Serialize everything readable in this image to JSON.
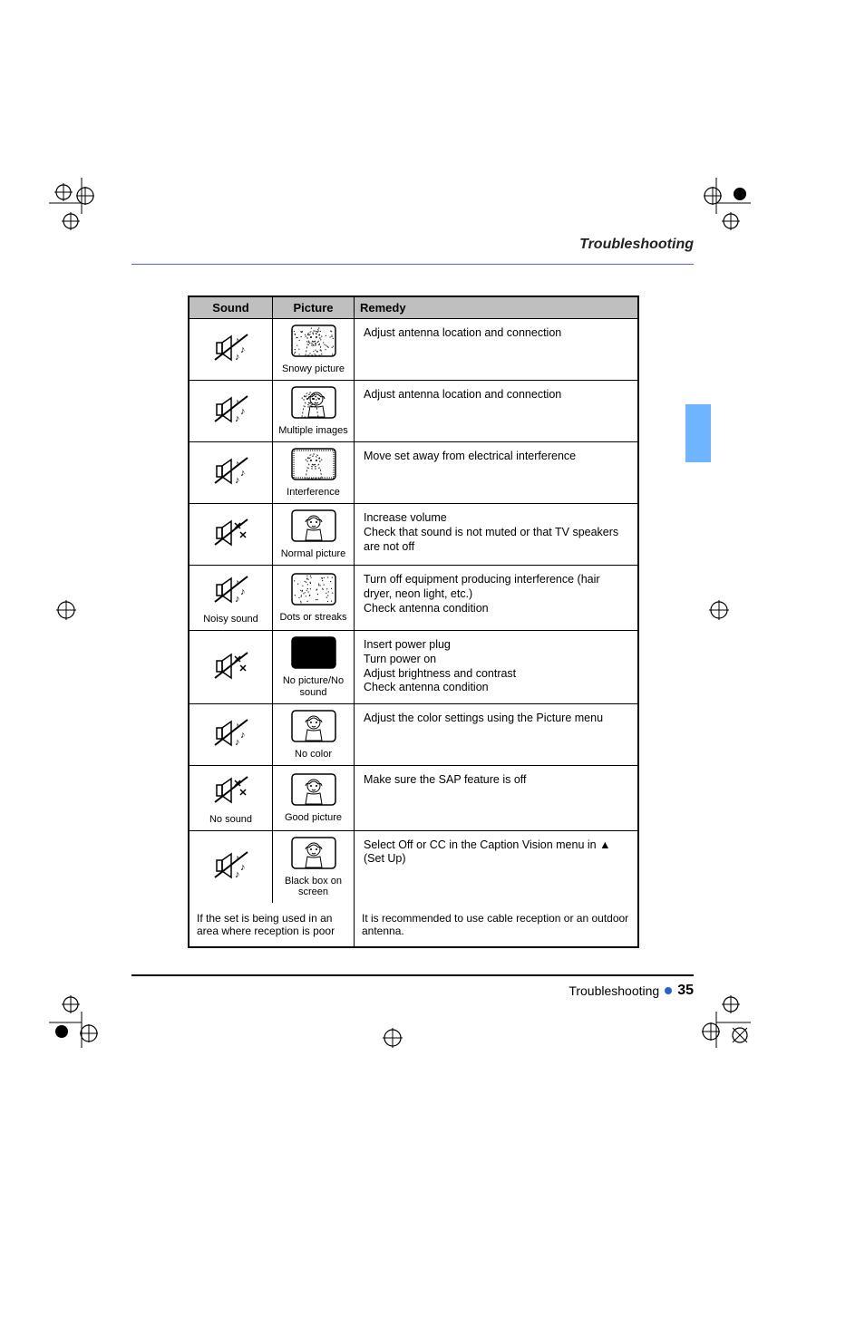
{
  "header": {
    "title": "Troubleshooting"
  },
  "sideTab": {
    "color": "#6fb4ff"
  },
  "table": {
    "headers": {
      "c1": "Sound",
      "c2": "Picture",
      "c3": "Remedy"
    },
    "rows": [
      {
        "sound": "ok",
        "soundCap": "",
        "pic": "snow",
        "picCap": "Snowy picture",
        "remedy": "Adjust antenna location and connection"
      },
      {
        "sound": "ok",
        "soundCap": "",
        "pic": "ghost",
        "picCap": "Multiple images",
        "remedy": "Adjust antenna location and connection"
      },
      {
        "sound": "ok",
        "soundCap": "",
        "pic": "inter",
        "picCap": "Interference",
        "remedy": "Move set away from electrical interference"
      },
      {
        "sound": "mute",
        "soundCap": "",
        "pic": "ok",
        "picCap": "Normal picture",
        "remedy": "Increase volume\nCheck that sound is not muted or that TV speakers are not off"
      },
      {
        "sound": "ok",
        "soundCap": "Noisy sound",
        "pic": "dots",
        "picCap": "Dots or streaks",
        "remedy": "Turn off equipment producing interference (hair dryer, neon light, etc.)\nCheck antenna condition"
      },
      {
        "sound": "mute",
        "soundCap": "",
        "pic": "black",
        "picCap": "No picture/No sound",
        "remedy": "Insert power plug\nTurn power on\nAdjust brightness and contrast\nCheck antenna condition"
      },
      {
        "sound": "ok",
        "soundCap": "",
        "pic": "ok",
        "picCap": "No color",
        "remedy": "Adjust the color settings using the Picture menu"
      },
      {
        "sound": "mute",
        "soundCap": "No sound",
        "pic": "ok",
        "picCap": "Good picture",
        "remedy": "Make sure the SAP feature is off"
      },
      {
        "sound": "ok",
        "soundCap": "",
        "pic": "ok",
        "picCap": "Black box on screen",
        "remedy": "Select Off or CC in the Caption Vision menu in ▲ (Set Up)"
      }
    ],
    "footnote": {
      "left": "If the set is being used in an area where reception is poor",
      "right": "It is recommended to use cable reception or an outdoor antenna."
    }
  },
  "footer": {
    "pageLabel": "Troubleshooting",
    "pageNum": "35"
  }
}
